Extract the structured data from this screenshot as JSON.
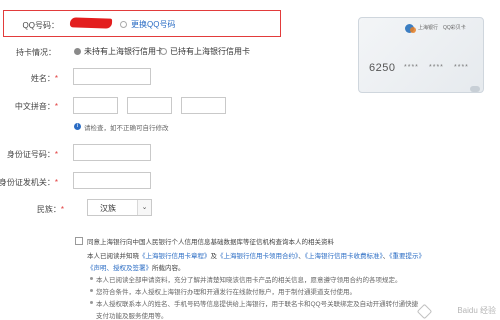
{
  "qq": {
    "label": "QQ号码：",
    "change_link": "更换QQ号码"
  },
  "card_holding": {
    "label": "持卡情况：",
    "options": [
      {
        "label": "未持有上海银行信用卡",
        "selected": true
      },
      {
        "label": "已持有上海银行信用卡",
        "selected": false
      }
    ]
  },
  "name": {
    "label": "姓名：",
    "required_mark": "*"
  },
  "pinyin": {
    "label": "中文拼音：",
    "required_mark": "*",
    "hint": "请检查，如不正确可自行修改"
  },
  "id_number": {
    "label": "身份证号码：",
    "required_mark": "*"
  },
  "id_issuer": {
    "label": "身份证发机关：",
    "required_mark": "*"
  },
  "ethnicity": {
    "label": "民族：",
    "required_mark": "*",
    "selected": "汉族"
  },
  "consent": {
    "line1": "同意上海银行向中国人民银行个人信用信息基础数据库等征信机构查询本人的相关资料",
    "line2_prefix": "本人已阅读并知晓",
    "links": [
      "《上海银行信用卡章程》",
      "《上海银行信用卡领用合约》",
      "《上海银行信用卡收费标准》",
      "《重要提示》",
      "《声明、授权及签署》"
    ],
    "line2_mid1": "及",
    "line2_sep": "、",
    "line3_suffix": "所载内容。",
    "bullets": [
      "本人已阅读全部申请资料，充分了解并清楚知晓该信用卡产品的相关信息，愿意遵守领用合约的各项规定。",
      "您符合条件，本人授权上海银行办理和开通发行在线款付账户，用于制付通渠道支付使用。",
      "本人授权联系本人的姓名、手机号码等信息提供给上海银行，用于联名卡和QQ号关联绑定及自动开通转付通快捷",
      "支付功能及服务使用等。"
    ]
  },
  "card_preview": {
    "bank_name": "上海银行",
    "brand": "QQ彩贝卡",
    "number_start": "6250",
    "masked_groups": [
      "****",
      "****",
      "****"
    ]
  },
  "watermark": "Baidu 经验"
}
